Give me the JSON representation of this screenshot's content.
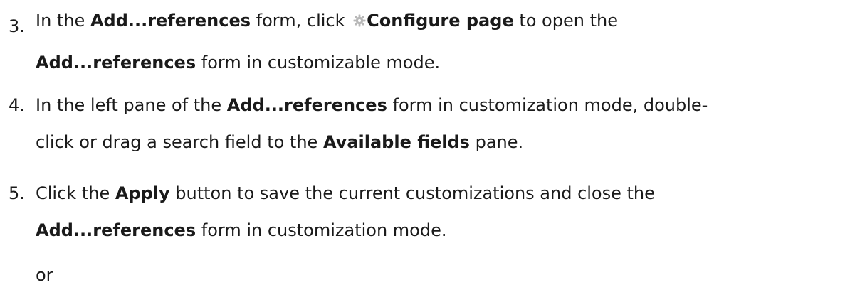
{
  "steps": [
    {
      "number": "3.",
      "line1": {
        "t1": "In the ",
        "b1": "Add...references",
        "t2": " form, click ",
        "icon": "gear-icon",
        "b2": "Configure page",
        "t3": " to open the"
      },
      "line2": {
        "b1": "Add...references",
        "t1": " form in customizable mode."
      }
    },
    {
      "number": "4.",
      "line1": {
        "t1": "In the left pane of the ",
        "b1": "Add...references",
        "t2": " form in customization mode, double-"
      },
      "line2": {
        "t1": "click or drag a search field to the ",
        "b1": "Available fields",
        "t2": " pane."
      }
    },
    {
      "number": "5.",
      "line1": {
        "t1": "Click the ",
        "b1": "Apply",
        "t2": " button to save the current customizations and close the"
      },
      "line2": {
        "b1": "Add...references",
        "t1": " form in customization mode."
      }
    }
  ],
  "or_text": "or",
  "colors": {
    "text": "#1a1a1a",
    "icon": "#b8b8b8"
  }
}
